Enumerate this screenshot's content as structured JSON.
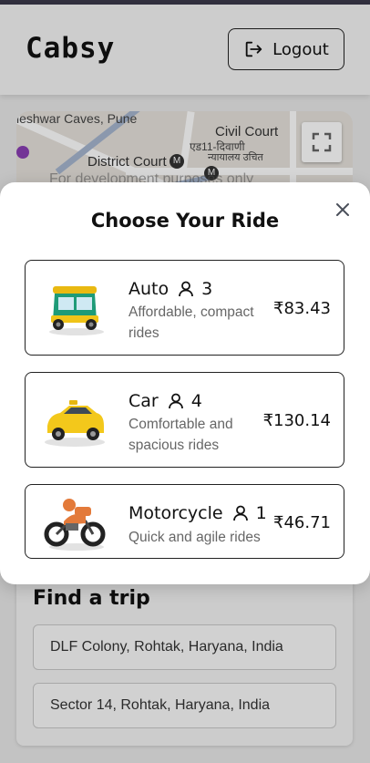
{
  "app": {
    "brand": "Cabsy"
  },
  "header": {
    "logout_label": "Logout"
  },
  "map": {
    "labels": [
      "ieshwar Caves, Pune",
      "Civil Court",
      "एड11-दिवाणी",
      "न्यायालय उचित",
      "District Court"
    ],
    "metro_badge": "M",
    "watermark": "For development purposes only"
  },
  "modal": {
    "title": "Choose Your Ride",
    "rides": [
      {
        "name": "Auto",
        "capacity": "3",
        "description": "Affordable, compact rides",
        "price": "₹83.43",
        "icon": "auto-rickshaw-icon"
      },
      {
        "name": "Car",
        "capacity": "4",
        "description": "Comfortable and spacious rides",
        "price": "₹130.14",
        "icon": "taxi-car-icon"
      },
      {
        "name": "Motorcycle",
        "capacity": "1",
        "description": "Quick and agile rides",
        "price": "₹46.71",
        "icon": "motorcycle-icon"
      }
    ]
  },
  "find_trip": {
    "title": "Find a trip",
    "pickup_value": "DLF Colony, Rohtak, Haryana, India",
    "dropoff_value": "Sector 14, Rohtak, Haryana, India"
  },
  "colors": {
    "overlay": "#00000029",
    "modal_bg": "#ffffff",
    "auto_yellow": "#f0c419",
    "auto_green": "#1e9b78",
    "taxi_yellow": "#f3c81b",
    "moto_orange": "#e37a3a"
  }
}
